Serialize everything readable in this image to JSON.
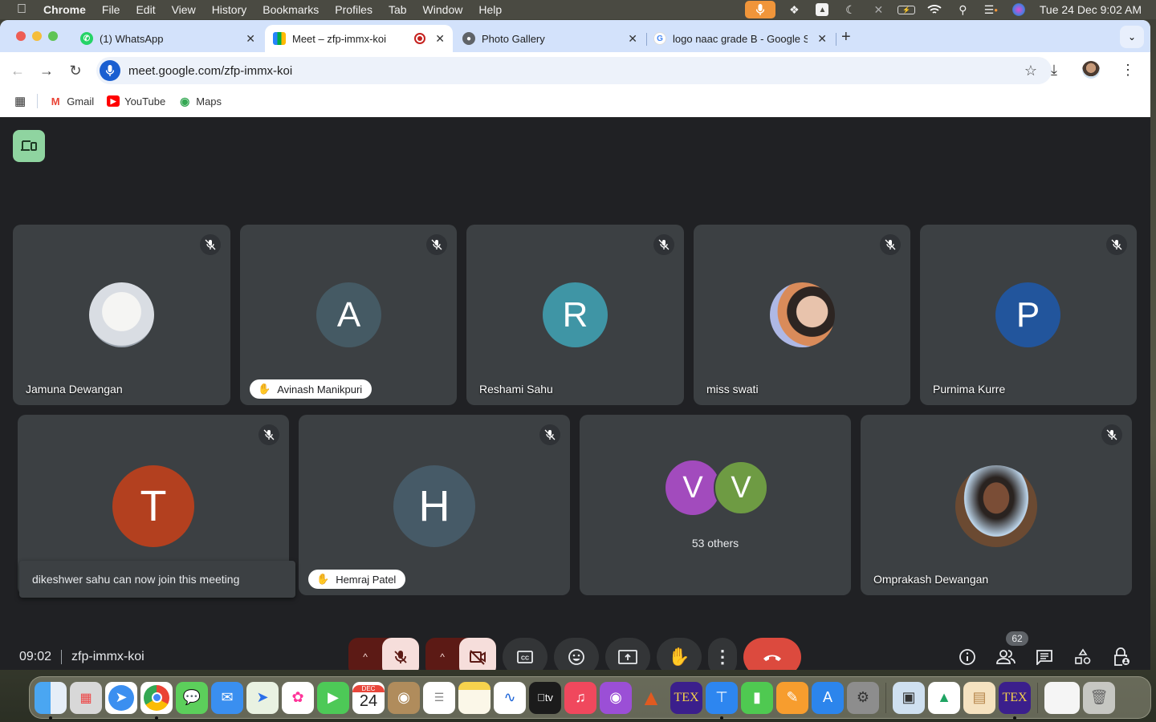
{
  "menubar": {
    "apple_icon": "apple-logo",
    "items": [
      "Chrome",
      "File",
      "Edit",
      "View",
      "History",
      "Bookmarks",
      "Profiles",
      "Tab",
      "Window",
      "Help"
    ],
    "status_icons": [
      "microphone-in-use",
      "dropbox",
      "google-drive",
      "moon-focus",
      "bluetooth-off",
      "battery-charging",
      "wifi",
      "spotlight-search",
      "control-center",
      "siri"
    ],
    "clock": "Tue 24 Dec  9:02 AM"
  },
  "browser": {
    "tabs": [
      {
        "title": "(1) WhatsApp",
        "favicon": "whatsapp",
        "active": false
      },
      {
        "title": "Meet – zfp-immx-koi",
        "favicon": "google-meet",
        "active": true,
        "recording": true
      },
      {
        "title": "Photo Gallery",
        "favicon": "globe",
        "active": false
      },
      {
        "title": "logo naac grade B - Google S",
        "favicon": "google",
        "active": false
      }
    ],
    "new_tab_label": "+",
    "url": "meet.google.com/zfp-immx-koi",
    "bookmarks": [
      {
        "label": "Gmail",
        "icon": "gmail"
      },
      {
        "label": "YouTube",
        "icon": "youtube"
      },
      {
        "label": "Maps",
        "icon": "google-maps"
      }
    ]
  },
  "meet": {
    "colors": {
      "bg": "#202124",
      "tile": "#3c4043",
      "end_call": "#dc4a3e",
      "muted_btn": "#f6dedb",
      "muted_btn_bg": "#5c1a15"
    },
    "tiles": [
      {
        "name": "Jamuna Dewangan",
        "avatar": "photo-polar-bear",
        "initial": "",
        "color": "",
        "muted": true,
        "hand_raised": false
      },
      {
        "name": "Avinash Manikpuri",
        "avatar": "initial",
        "initial": "A",
        "color": "#455a64",
        "muted": true,
        "hand_raised": true
      },
      {
        "name": "Reshami Sahu",
        "avatar": "initial",
        "initial": "R",
        "color": "#3f95a5",
        "muted": true,
        "hand_raised": false
      },
      {
        "name": "miss swati",
        "avatar": "photo",
        "initial": "",
        "color": "",
        "muted": true,
        "hand_raised": false
      },
      {
        "name": "Purnima Kurre",
        "avatar": "initial",
        "initial": "P",
        "color": "#22559c",
        "muted": true,
        "hand_raised": false
      },
      {
        "name": "",
        "avatar": "initial",
        "initial": "T",
        "color": "#b3401f",
        "muted": true,
        "hand_raised": false
      },
      {
        "name": "Hemraj Patel",
        "avatar": "initial",
        "initial": "H",
        "color": "#465a67",
        "muted": true,
        "hand_raised": true
      },
      {
        "name": "",
        "avatar": "group",
        "initials": [
          "V",
          "V"
        ],
        "colors": [
          "#a24bbd",
          "#6e9b43"
        ],
        "others_label": "53 others"
      },
      {
        "name": "Omprakash Dewangan",
        "avatar": "photo",
        "initial": "",
        "color": "",
        "muted": true,
        "hand_raised": false
      }
    ],
    "toast": "dikeshwer sahu can now join this meeting",
    "time": "09:02",
    "meeting_code": "zfp-immx-koi",
    "controls": [
      "mic-off",
      "camera-off",
      "captions",
      "emoji-reactions",
      "present-screen",
      "raise-hand",
      "more-options",
      "leave-call"
    ],
    "right_controls": [
      "meeting-details",
      "people",
      "chat",
      "activities",
      "host-controls"
    ],
    "participant_count": "62"
  },
  "dock": {
    "apps": [
      "Finder",
      "Launchpad",
      "Safari",
      "Chrome",
      "Messages",
      "Mail",
      "Maps",
      "Photos",
      "FaceTime",
      "Calendar",
      "Contacts",
      "Reminders",
      "Notes",
      "Freeform",
      "TV",
      "Music",
      "Podcasts",
      "MATLAB",
      "TeXShop",
      "Keynote",
      "Numbers",
      "Pages",
      "App Store",
      "System Settings"
    ],
    "calendar_month": "DEC",
    "calendar_day": "24",
    "tv_label": "tv",
    "extra": [
      "Preview",
      "Google Drive",
      "Archive Utility",
      "TeXShop"
    ],
    "trash": "Trash"
  }
}
